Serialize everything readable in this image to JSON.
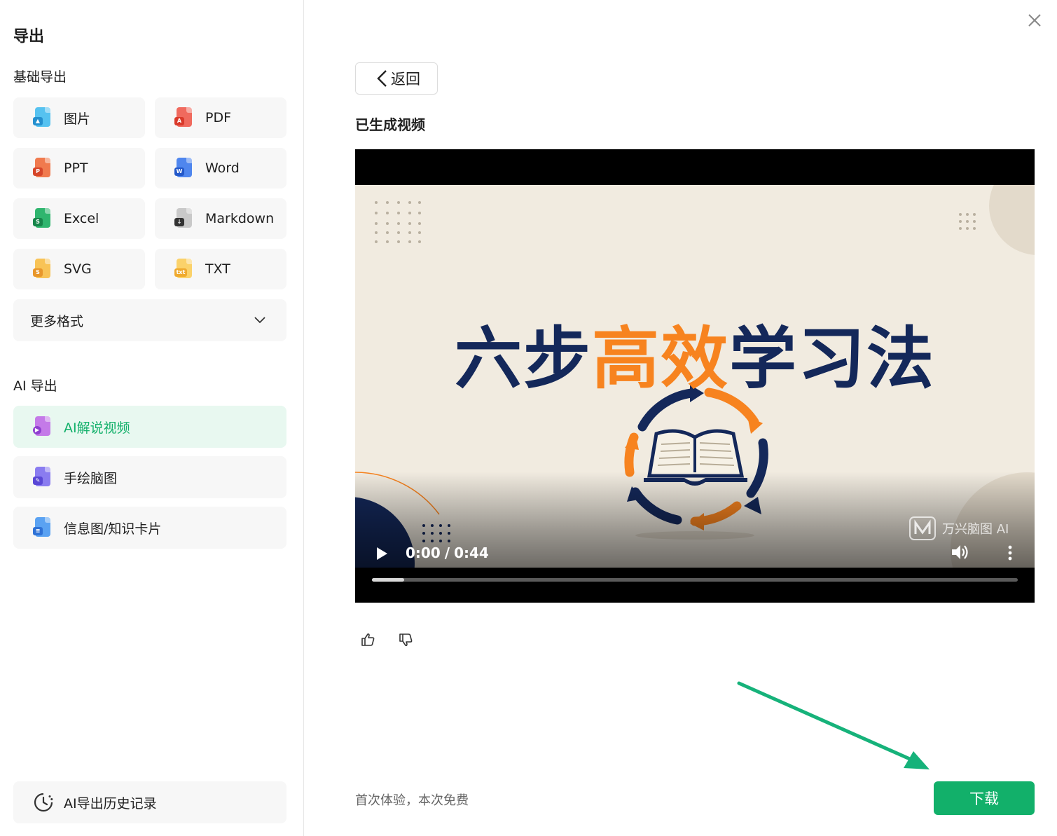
{
  "sidebar": {
    "title": "导出",
    "basic_label": "基础导出",
    "formats": [
      {
        "label": "图片",
        "color": "#3fb0e8"
      },
      {
        "label": "PDF",
        "color": "#e84a3c"
      },
      {
        "label": "PPT",
        "color": "#e65a2b"
      },
      {
        "label": "Word",
        "color": "#2f6be0"
      },
      {
        "label": "Excel",
        "color": "#1e9b5a"
      },
      {
        "label": "Markdown",
        "color": "#4a4a4a"
      },
      {
        "label": "SVG",
        "color": "#f0a72c"
      },
      {
        "label": "TXT",
        "color": "#f5b83d"
      }
    ],
    "more_formats": "更多格式",
    "ai_label": "AI 导出",
    "ai_items": [
      {
        "label": "AI解说视频",
        "active": true
      },
      {
        "label": "手绘脑图",
        "active": false
      },
      {
        "label": "信息图/知识卡片",
        "active": false
      }
    ],
    "history": "AI导出历史记录"
  },
  "main": {
    "back_label": "返回",
    "generated_title": "已生成视频",
    "video": {
      "title_part1": "六步",
      "title_part2": "高效",
      "title_part3": "学习法",
      "current_time": "0:00",
      "separator": "/",
      "duration": "0:44",
      "progress": 0.05,
      "watermark": "万兴脑图 AI"
    },
    "free_note": "首次体验，本次免费",
    "download_label": "下载"
  },
  "colors": {
    "accent": "#12b06a",
    "title_navy": "#14285a",
    "title_orange": "#f7831f"
  }
}
